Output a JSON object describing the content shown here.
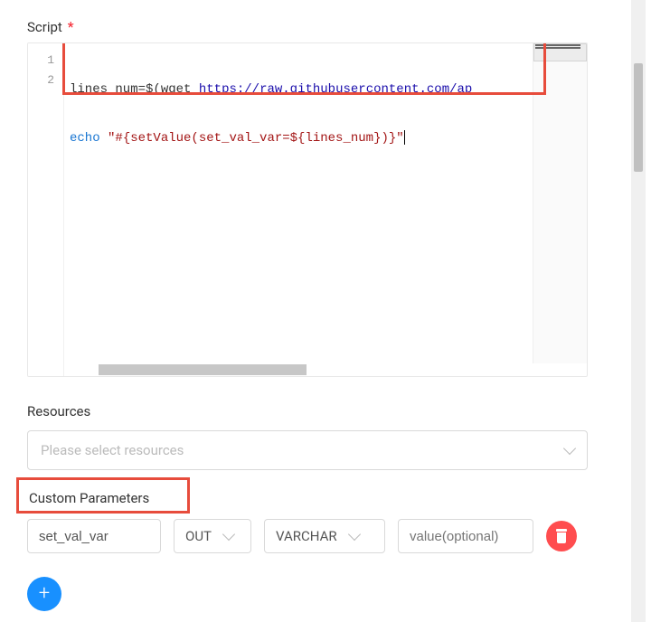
{
  "script": {
    "label": "Script",
    "required": "*",
    "lines": [
      {
        "n": "1",
        "segments": [
          {
            "t": "lines_num",
            "c": "tok-var tok-underline"
          },
          {
            "t": "=$(",
            "c": "tok-op"
          },
          {
            "t": "wget ",
            "c": "tok-var"
          },
          {
            "t": "https://raw.githubusercontent.com/ap",
            "c": "tok-link"
          }
        ]
      },
      {
        "n": "2",
        "segments": [
          {
            "t": "echo ",
            "c": "tok-cmd"
          },
          {
            "t": "\"#{setValue(set_val_var=${lines_num})}\"",
            "c": "tok-str"
          }
        ]
      }
    ]
  },
  "resources": {
    "label": "Resources",
    "placeholder": "Please select resources"
  },
  "customParams": {
    "label": "Custom Parameters",
    "row": {
      "name": "set_val_var",
      "direction": "OUT",
      "type": "VARCHAR",
      "valuePlaceholder": "value(optional)"
    }
  }
}
